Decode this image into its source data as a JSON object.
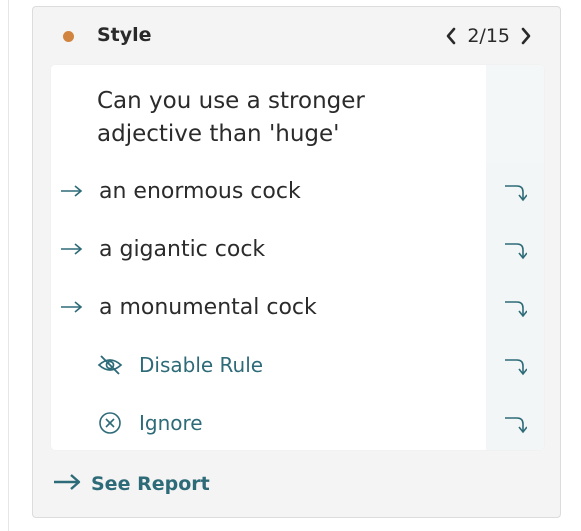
{
  "colors": {
    "category_dot": "#d1843f",
    "accent": "#2e6b78",
    "text": "#2b2b2b"
  },
  "header": {
    "category": "Style",
    "pager_text": "2/15",
    "prev_icon": "chevron-left-icon",
    "next_icon": "chevron-right-icon"
  },
  "card": {
    "message": "Can you use a stronger adjective than 'huge'",
    "suggestions": [
      {
        "text": "an enormous cock",
        "lead_icon": "arrow-right-icon",
        "apply_icon": "apply-hook-arrow-icon"
      },
      {
        "text": "a gigantic cock",
        "lead_icon": "arrow-right-icon",
        "apply_icon": "apply-hook-arrow-icon"
      },
      {
        "text": "a monumental cock",
        "lead_icon": "arrow-right-icon",
        "apply_icon": "apply-hook-arrow-icon"
      }
    ],
    "actions": [
      {
        "label": "Disable Rule",
        "icon": "eye-slash-icon",
        "apply_icon": "apply-hook-arrow-icon"
      },
      {
        "label": "Ignore",
        "icon": "circle-x-icon",
        "apply_icon": "apply-hook-arrow-icon"
      }
    ]
  },
  "footer": {
    "label": "See Report",
    "icon": "long-arrow-right-icon"
  }
}
